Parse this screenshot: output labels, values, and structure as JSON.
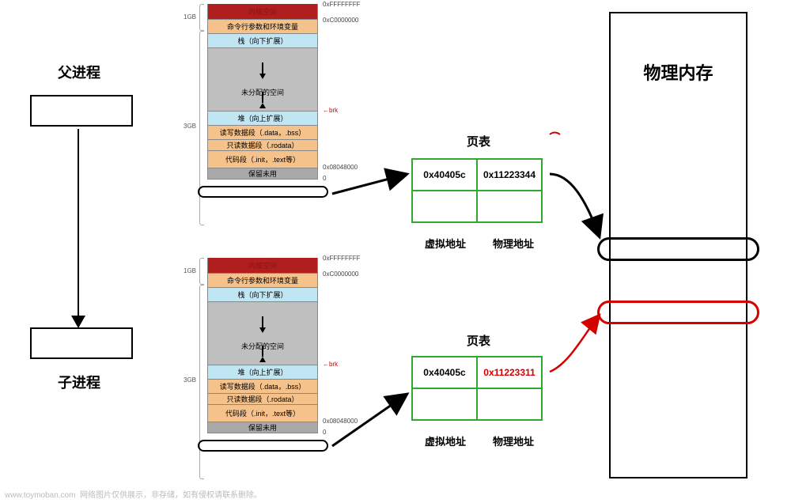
{
  "left": {
    "parent_label": "父进程",
    "child_label": "子进程"
  },
  "physical_memory_label": "物理内存",
  "page_table_label": "页表",
  "virt_addr_label": "虚拟地址",
  "phys_addr_label": "物理地址",
  "mem": {
    "kernel": "内核空间",
    "args_env": "命令行参数和环境变量",
    "stack": "栈（向下扩展）",
    "unalloc": "未分配的空间",
    "heap": "堆（向上扩展）",
    "rw_data": "读写数据段（.data，.bss）",
    "ro_data": "只读数据段（.rodata）",
    "code": "代码段（.init，.text等）",
    "reserved": "保留未用",
    "brk": "brk",
    "addr_top": "0xFFFFFFFF",
    "addr_c0": "0xC0000000",
    "addr_08048": "0x08048000",
    "addr_0": "0",
    "size_1g": "1GB",
    "size_3g": "3GB"
  },
  "pt1": {
    "r0c0": "0x40405c",
    "r0c1": "0x11223344"
  },
  "pt2": {
    "r0c0": "0x40405c",
    "r0c1": "0x11223311"
  },
  "footer_site": "www.toymoban.com",
  "footer_text": "网络图片仅供展示，非存储，如有侵权请联系删除。"
}
